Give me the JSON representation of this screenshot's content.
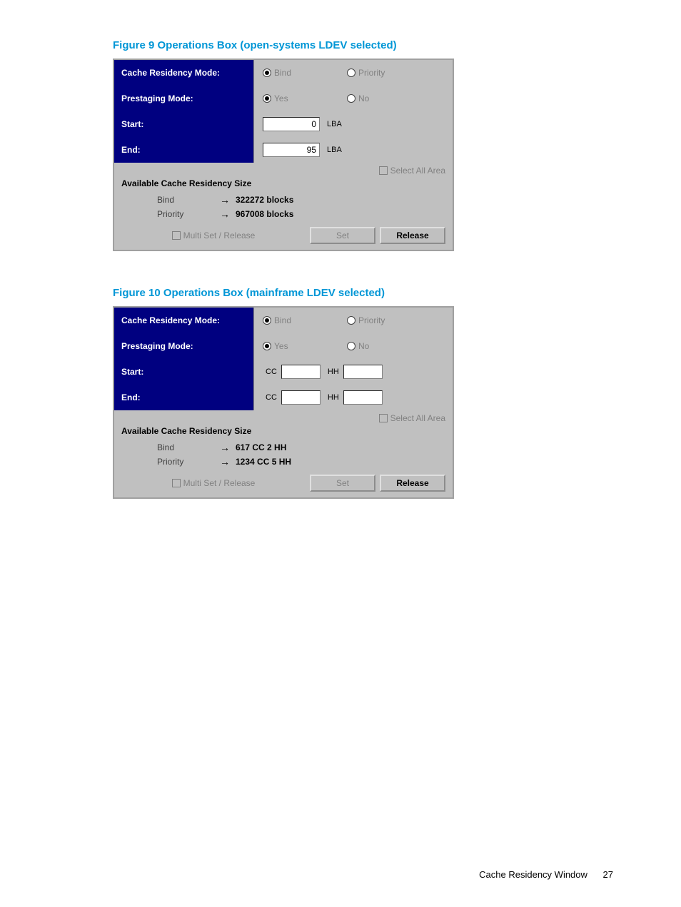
{
  "figures": {
    "f9": {
      "caption": "Figure 9 Operations Box (open-systems LDEV selected)",
      "cacheResidencyLabel": "Cache Residency Mode:",
      "prestagingLabel": "Prestaging Mode:",
      "startLabel": "Start:",
      "endLabel": "End:",
      "bindRadio": "Bind",
      "priorityRadio": "Priority",
      "yesRadio": "Yes",
      "noRadio": "No",
      "startVal": "0",
      "startUnit": "LBA",
      "endVal": "95",
      "endUnit": "LBA",
      "selectAll": "Select All Area",
      "sizeHeader": "Available Cache Residency Size",
      "bindName": "Bind",
      "priorityName": "Priority",
      "bindBlocks": "322272 blocks",
      "priorityBlocks": "967008 blocks",
      "multiSet": "Multi Set / Release",
      "setBtn": "Set",
      "releaseBtn": "Release"
    },
    "f10": {
      "caption": "Figure 10 Operations Box (mainframe LDEV selected)",
      "cacheResidencyLabel": "Cache Residency Mode:",
      "prestagingLabel": "Prestaging Mode:",
      "startLabel": "Start:",
      "endLabel": "End:",
      "bindRadio": "Bind",
      "priorityRadio": "Priority",
      "yesRadio": "Yes",
      "noRadio": "No",
      "ccUnit": "CC",
      "hhUnit": "HH",
      "selectAll": "Select All Area",
      "sizeHeader": "Available Cache Residency Size",
      "bindName": "Bind",
      "priorityName": "Priority",
      "bindBlocks": "617 CC 2 HH",
      "priorityBlocks": "1234 CC 5 HH",
      "multiSet": "Multi Set / Release",
      "setBtn": "Set",
      "releaseBtn": "Release"
    }
  },
  "footer": {
    "text": "Cache Residency Window",
    "page": "27"
  }
}
